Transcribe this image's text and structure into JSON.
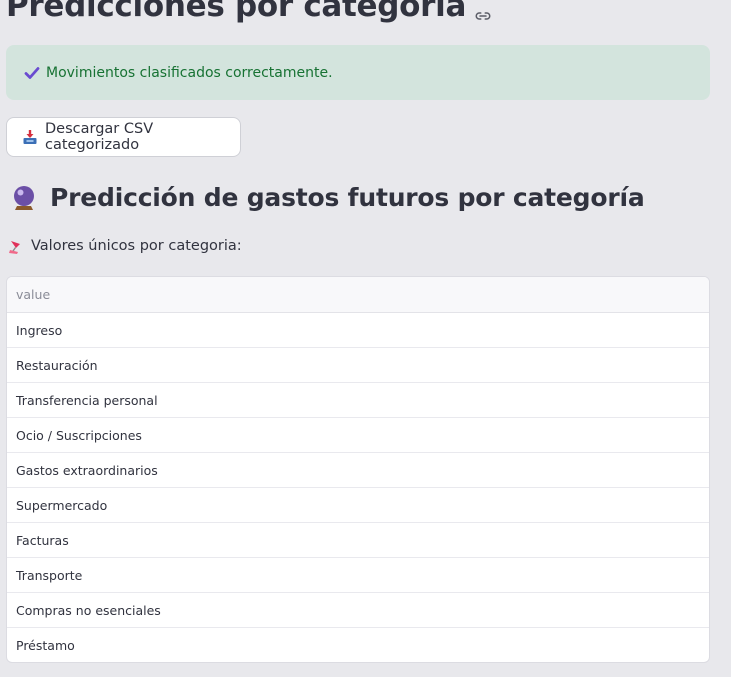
{
  "page": {
    "title": "Predicciones por categoría"
  },
  "alert": {
    "message": "Movimientos clasificados correctamente.",
    "icon": "check-icon",
    "color": "#177233"
  },
  "download": {
    "label": "Descargar CSV categorizado",
    "icon": "inbox-tray-icon"
  },
  "section": {
    "heading": "Predicción de gastos futuros por categoría",
    "icon": "crystal-ball-icon"
  },
  "caption": {
    "text": "Valores únicos por categoria:",
    "icon": "pin-icon"
  },
  "table": {
    "columns": [
      "value"
    ],
    "rows": [
      "Ingreso",
      "Restauración",
      "Transferencia personal",
      "Ocio / Suscripciones",
      "Gastos extraordinarios",
      "Supermercado",
      "Facturas",
      "Transporte",
      "Compras no esenciales",
      "Préstamo"
    ]
  }
}
